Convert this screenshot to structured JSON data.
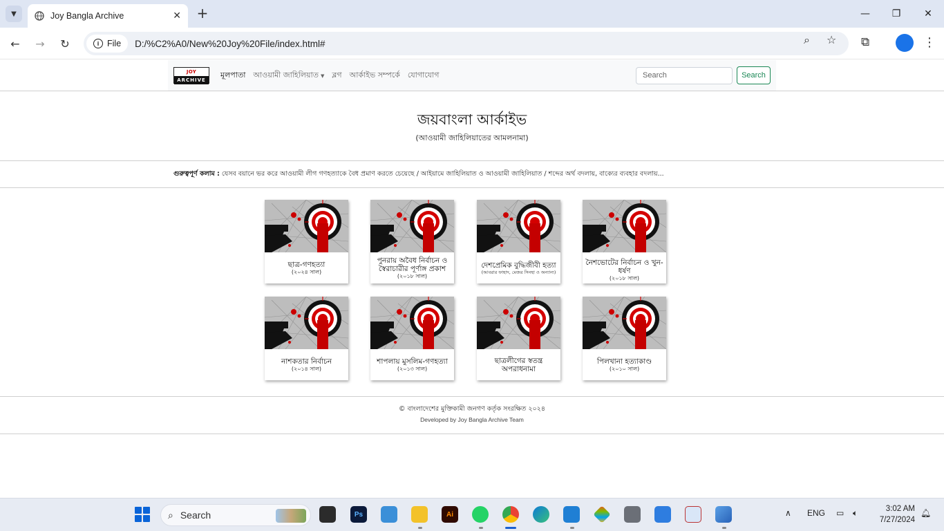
{
  "browser": {
    "tab_title": "Joy Bangla Archive",
    "new_tab": "+",
    "site_chip": "File",
    "url": "D:/%C2%A0/New%20Joy%20File/index.html#",
    "controls": {
      "minimize": "—",
      "maximize": "❐",
      "close": "✕"
    }
  },
  "navbar": {
    "brand_top": "JOY BANGLA",
    "brand_bottom": "ARCHIVE",
    "links": [
      "মূলপাতা",
      "আওয়ামী জাহিলিয়াত",
      "ব্লগ",
      "আর্কাইভ সম্পর্কে",
      "যোগাযোগ"
    ],
    "dropdown_caret": "▼",
    "search_placeholder": "Search",
    "search_button": "Search"
  },
  "header": {
    "title": "জয়বাংলা আর্কাইভ",
    "subtitle": "(আওয়ামী জাহিলিয়াতের আমলনামা)"
  },
  "important_columns": {
    "label": "গুরুত্বপূর্ণ কলাম :",
    "text": " যেসব বয়ানে ভর করে আওয়ামী লীগ গণহত্যাকে বৈধ প্রমাণ করতে চেয়েছে / আইয়ামে জাহিলিয়াত ও আওয়ামী জাহিলিয়াত / শব্দের অর্থ বদলায়, বাক্যের ব্যবহার বদলায়..."
  },
  "cards": [
    {
      "title": "ছাত্র-গণহত্যা",
      "year": "(২০২৪ সাল)",
      "note": ""
    },
    {
      "title": "পুনরায় অবৈধ নির্বাচন ও স্বৈরাচারীর পূর্ণাঙ্গ প্রকাশ",
      "year": "(২০১৮ সাল)",
      "note": ""
    },
    {
      "title": "দেশপ্রেমিক বুদ্ধিজীবী হত্যা",
      "year": "",
      "note": "(আবরার ফাহাদ, মেজর সিনহা ও অন্যান্য)"
    },
    {
      "title": "নৈশভোটের নির্বাচন ও খুন-ধর্ষণ",
      "year": "(২০১৮ সাল)",
      "note": ""
    },
    {
      "title": "নাশকতার নির্বাচন",
      "year": "(২০১৪ সাল)",
      "note": ""
    },
    {
      "title": "শাপলায় মুসলিম-গণহত্যা",
      "year": "(২০১৩ সাল)",
      "note": ""
    },
    {
      "title": "ছাত্রলীগের স্বতন্ত্র অপরাধনামা",
      "year": "",
      "note": ""
    },
    {
      "title": "পিলখানা হত্যাকাণ্ড",
      "year": "(২০১০ সাল)",
      "note": ""
    }
  ],
  "footer": {
    "copyright": "© বাংলাদেশের মুক্তিকামী জনগণ কর্তৃক সংরক্ষিত ২০২৪",
    "developed_by": "Developed by Joy Bangla Archive Team"
  },
  "taskbar": {
    "search_placeholder": "Search",
    "language": "ENG",
    "time": "3:02 AM",
    "date": "7/27/2024"
  }
}
